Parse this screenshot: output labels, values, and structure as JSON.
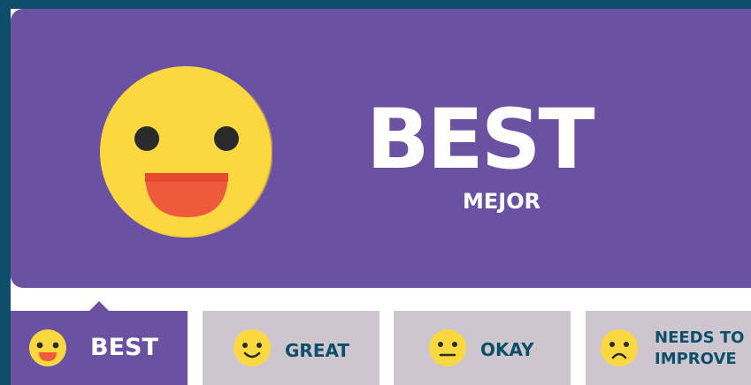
{
  "hero": {
    "title": "BEST",
    "subtitle": "MEJOR",
    "face_icon": "grinning-face-tongue-icon"
  },
  "tabs": [
    {
      "label": "BEST",
      "face_icon": "grinning-face-tongue-icon",
      "active": true
    },
    {
      "label": "GREAT",
      "face_icon": "smiling-face-icon",
      "active": false
    },
    {
      "label": "OKAY",
      "face_icon": "neutral-face-icon",
      "active": false
    },
    {
      "label_line1": "NEEDS TO",
      "label_line2": "IMPROVE",
      "face_icon": "frowning-face-icon",
      "active": false
    }
  ],
  "colors": {
    "background": "#0d4f6b",
    "hero": "#6b51a1",
    "tab_inactive": "#cdc6cf",
    "tab_label": "#0d4f6b",
    "face_yellow": "#fcd840",
    "face_mouth": "#f05a3c",
    "face_features": "#2b2b2b"
  }
}
